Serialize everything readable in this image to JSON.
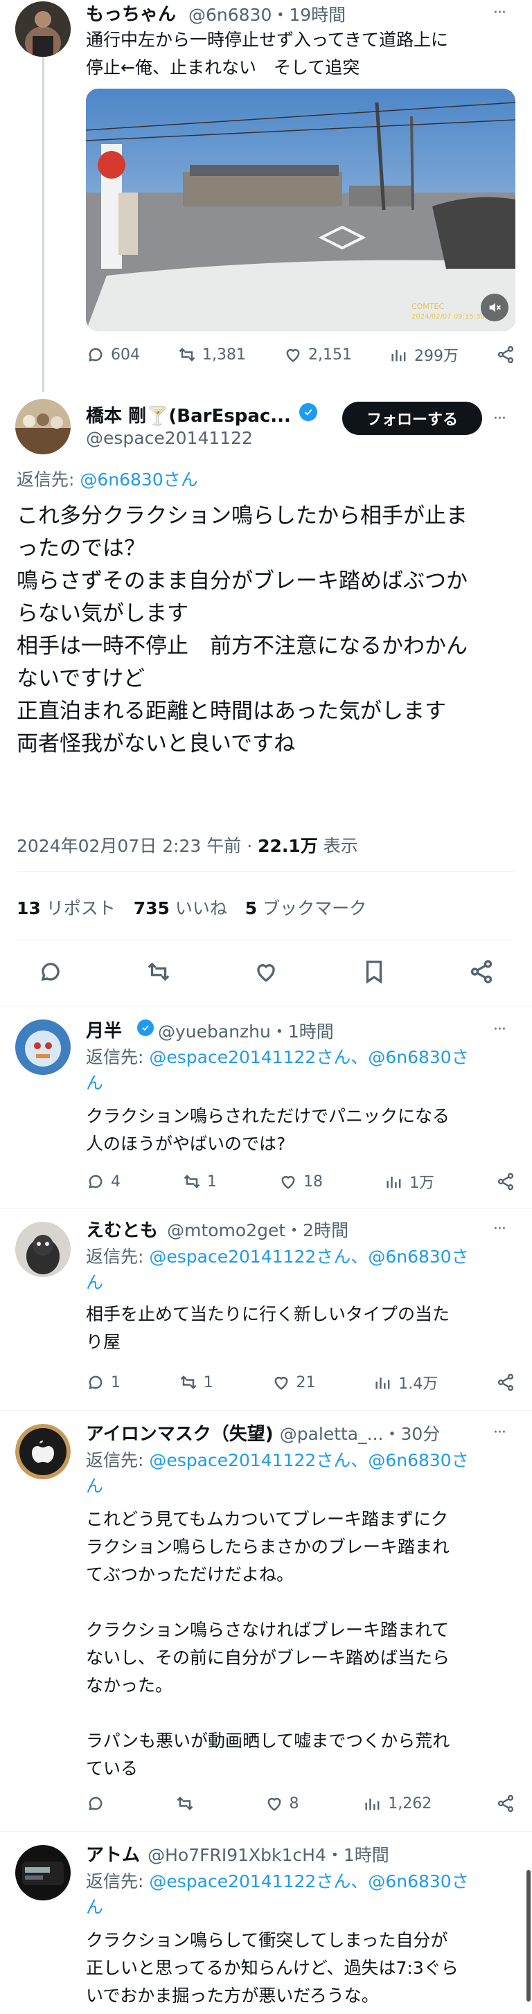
{
  "parent": {
    "name": "もっちゃん",
    "handle": "@6n6830",
    "time": "・19時間",
    "text_lines": [
      "通行中左から一時停止せず入ってきて道路上に",
      "停止←俺、止まれない　そして追突"
    ],
    "video_timestamp": "2024/02/07 09:15:30",
    "video_brand": "COMTEC",
    "stats": {
      "replies": "604",
      "reposts": "1,381",
      "likes": "2,151",
      "views": "299万"
    }
  },
  "main": {
    "name": "橋本 剛🍸(BarEspac...",
    "handle": "@espace20141122",
    "follow_label": "フォローする",
    "reply_to_prefix": "返信先: ",
    "reply_to_user": "@6n6830さん",
    "text_lines": [
      "これ多分クラクション鳴らしたから相手が止ま",
      "ったのでは？",
      "鳴らさずそのまま自分がブレーキ踏めばぶつか",
      "らない気がします",
      "相手は一時不停止　前方不注意になるかわかん",
      "ないですけど",
      "正直泊まれる距離と時間はあった気がします",
      "両者怪我がないと良いですね"
    ],
    "datetime": "2024年02月07日 2:23 午前 · ",
    "views_count": "22.1万",
    "views_label": " 表示",
    "reposts_count": "13",
    "reposts_label": " リポスト",
    "likes_count": "735",
    "likes_label": " いいね",
    "bookmarks_count": "5",
    "bookmarks_label": " ブックマーク"
  },
  "replies": [
    {
      "name": "月半",
      "handle": "@yuebanzhu",
      "time": "・1時間",
      "reply_to_prefix": "返信先: ",
      "reply_to_line1": "@espace20141122さん、@6n6830さ",
      "reply_to_line2": "ん",
      "text_lines": [
        "クラクション鳴らされただけでパニックになる",
        "人のほうがやばいのでは?"
      ],
      "stats": {
        "replies": "4",
        "reposts": "1",
        "likes": "18",
        "views": "1万"
      }
    },
    {
      "name": "えむとも",
      "handle": "@mtomo2get",
      "time": "・2時間",
      "reply_to_prefix": "返信先: ",
      "reply_to_line1": "@espace20141122さん、@6n6830さ",
      "reply_to_line2": "ん",
      "text_lines": [
        "相手を止めて当たりに行く新しいタイプの当た",
        "り屋"
      ],
      "stats": {
        "replies": "1",
        "reposts": "1",
        "likes": "21",
        "views": "1.4万"
      }
    },
    {
      "name": "アイロンマスク（失望)",
      "handle": "@paletta_...",
      "time": "・30分",
      "reply_to_prefix": "返信先: ",
      "reply_to_line1": "@espace20141122さん、@6n6830さ",
      "reply_to_line2": "ん",
      "text_lines": [
        "これどう見てもムカついてブレーキ踏まずにク",
        "ラクション鳴らしたらまさかのブレーキ踏まれ",
        "てぶつかっただけだよね。",
        "",
        "クラクション鳴らさなければブレーキ踏まれて",
        "ないし、その前に自分がブレーキ踏めば当たら",
        "なかった。",
        "",
        "ラパンも悪いが動画晒して嘘までつくから荒れ",
        "ている"
      ],
      "stats": {
        "replies": "",
        "reposts": "",
        "likes": "8",
        "views": "1,262"
      }
    },
    {
      "name": "アトム",
      "handle": "@Ho7FRI91Xbk1cH4",
      "time": "・1時間",
      "reply_to_prefix": "返信先: ",
      "reply_to_line1": "@espace20141122さん、@6n6830さ",
      "reply_to_line2": "ん",
      "text_lines": [
        "クラクション鳴らして衝突してしまった自分が",
        "正しいと思ってるか知らんけど、過失は7:3ぐら",
        "いでおかま掘った方が悪いだろうな。"
      ]
    }
  ],
  "colors": {
    "accent": "#1d9bf0",
    "text": "#0f1419",
    "muted": "#536471",
    "follow_bg": "#0f1419"
  }
}
